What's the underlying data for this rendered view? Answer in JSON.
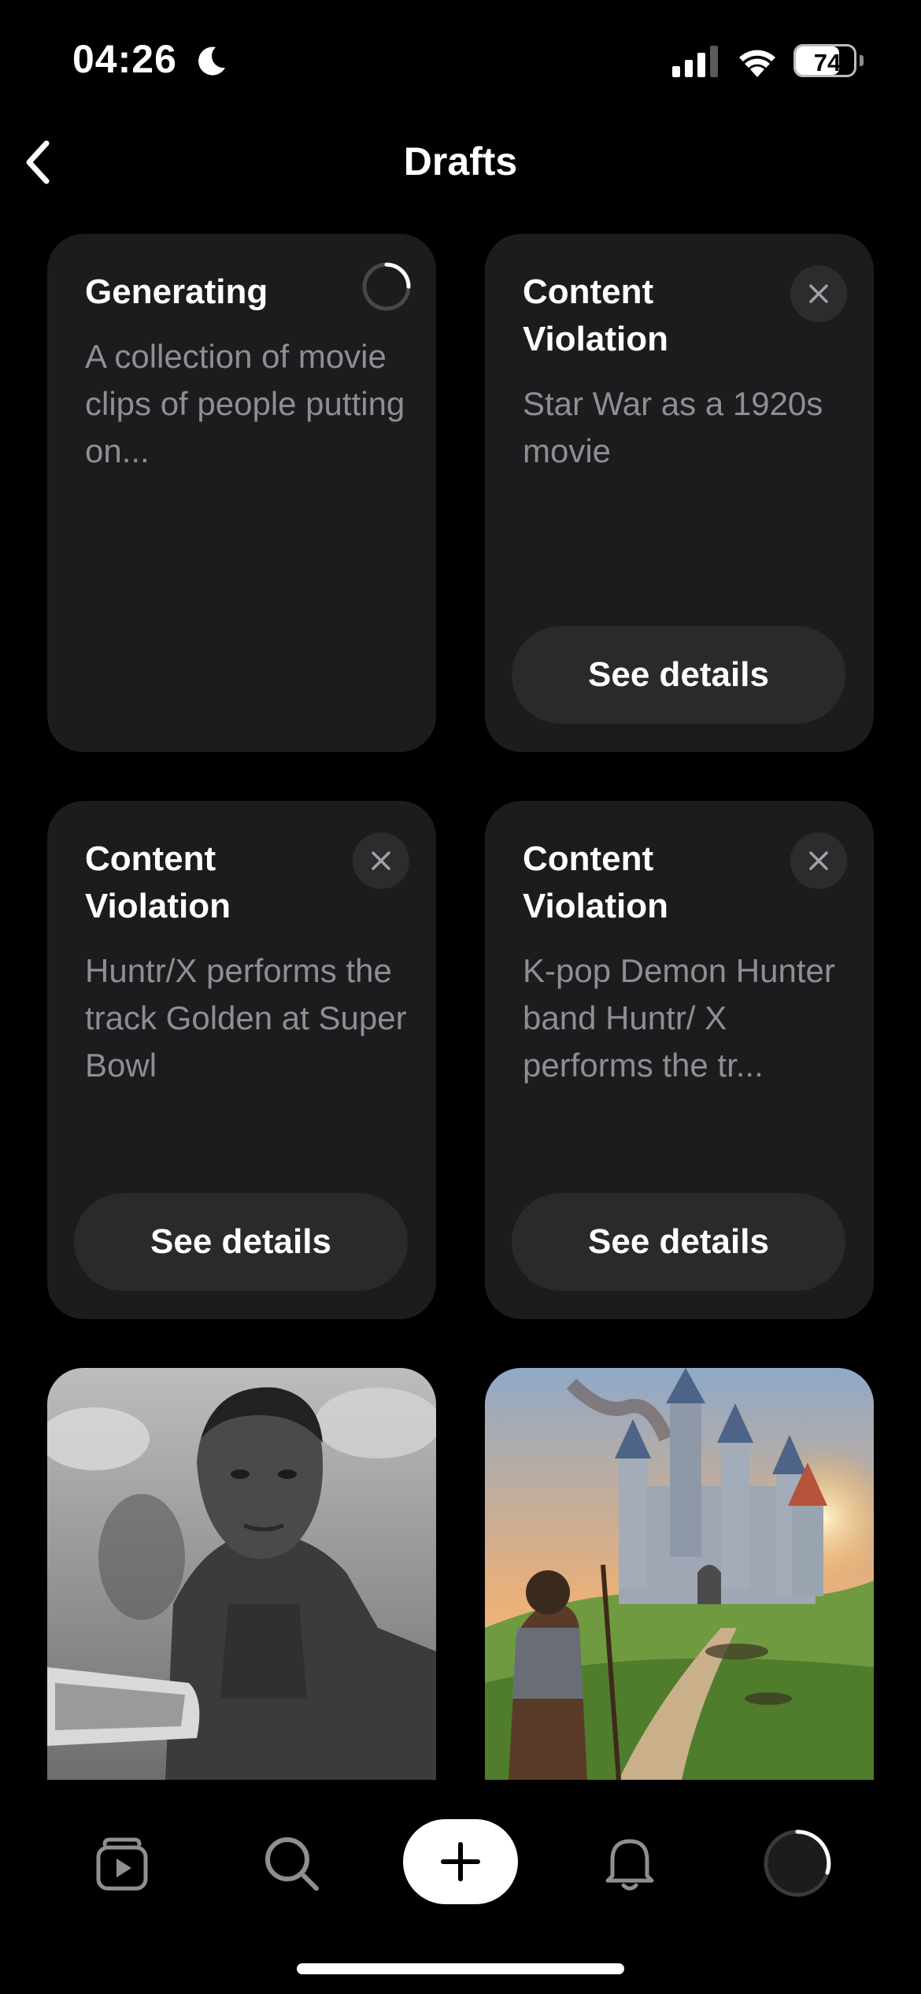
{
  "status_bar": {
    "time": "04:26",
    "battery": "74",
    "battery_level": 0.74
  },
  "header": {
    "title": "Drafts"
  },
  "drafts": [
    {
      "title": "Generating",
      "description": "A collection of movie clips of people putting on..."
    },
    {
      "title": "Content Violation",
      "description": "Star War as a 1920s movie",
      "action": "See details"
    },
    {
      "title": "Content Violation",
      "description": "Huntr/X performs the track Golden at Super Bowl",
      "action": "See details"
    },
    {
      "title": "Content Violation",
      "description": "K-pop Demon Hunter band Huntr/ X performs the tr...",
      "action": "See details"
    }
  ],
  "thumbnails": [
    {
      "icon": "soldier-grayscale-thumbnail"
    },
    {
      "icon": "castle-sunset-thumbnail"
    }
  ],
  "tab_bar": {
    "items": [
      {
        "icon": "play-feed-icon"
      },
      {
        "icon": "search-icon"
      },
      {
        "icon": "plus-icon"
      },
      {
        "icon": "bell-icon"
      },
      {
        "icon": "profile-avatar-icon"
      }
    ]
  },
  "colors": {
    "background": "#000000",
    "card": "#1c1c1e",
    "button": "#2a2a2c",
    "muted_text": "#8e8e93"
  }
}
